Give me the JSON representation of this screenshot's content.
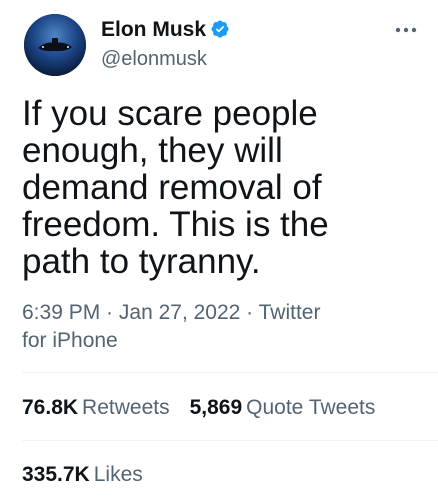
{
  "author": {
    "name": "Elon Musk",
    "handle": "@elonmusk",
    "verified": true,
    "avatar": "avatar-image"
  },
  "tweet": {
    "text_lines": [
      "If you scare people",
      "enough, they will",
      "demand removal of",
      "freedom. This is the",
      "path to tyranny."
    ],
    "time": "6:39 PM",
    "date": "Jan 27, 2022",
    "source_line1": "Twitter",
    "source_line2": "for iPhone"
  },
  "stats": {
    "retweets": {
      "count": "76.8K",
      "label": "Retweets"
    },
    "quote_tweets": {
      "count": "5,869",
      "label": "Quote Tweets"
    },
    "likes": {
      "count": "335.7K",
      "label": "Likes"
    }
  },
  "icons": {
    "verified": "verified-badge-icon",
    "more": "more-options-icon"
  },
  "colors": {
    "text": "#0f1419",
    "secondary": "#536471",
    "verified_blue": "#1d9bf0",
    "divider": "#eff3f4"
  }
}
